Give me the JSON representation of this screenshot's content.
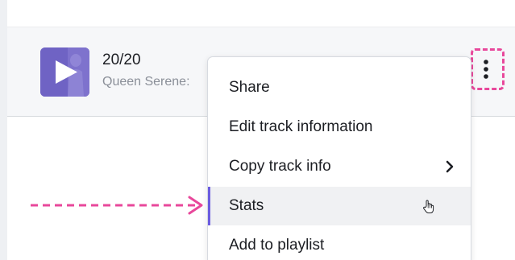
{
  "track": {
    "title": "20/20",
    "artist": "Queen Serene:"
  },
  "menu": {
    "items": [
      {
        "label": "Share"
      },
      {
        "label": "Edit track information"
      },
      {
        "label": "Copy track info",
        "has_submenu": true
      },
      {
        "label": "Stats",
        "active": true
      },
      {
        "label": "Add to playlist"
      }
    ]
  },
  "colors": {
    "annotation": "#e8489b",
    "accent": "#6b5ce0",
    "thumbnail": "#6f63c4"
  }
}
